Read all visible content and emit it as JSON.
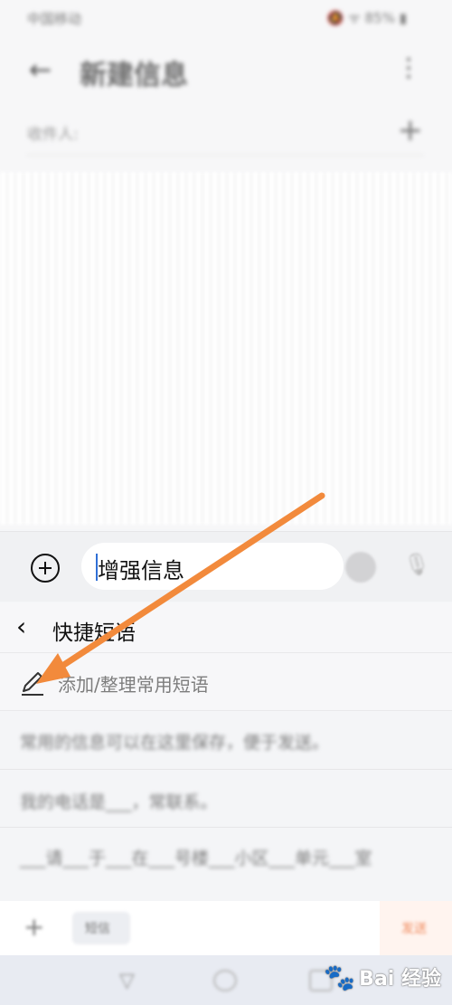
{
  "status_bar": {
    "left": "中国移动",
    "right": "🔕 ᯤ 85% ▮"
  },
  "header": {
    "title": "新建信息"
  },
  "recipient": {
    "placeholder": "收件人:"
  },
  "composer": {
    "input_value": "增强信息"
  },
  "quick_phrases": {
    "title": "快捷短语",
    "add_label": "添加/整理常用短语",
    "items": [
      "常用的信息可以在这里保存，便于发送。",
      "我的电话是___，常联系。",
      "___请___于___在___号楼___小区___单元___室"
    ]
  },
  "bottom_bar": {
    "chip_label": "短信",
    "right_label": "发送"
  },
  "watermark": {
    "text": "Bai 经验"
  },
  "colors": {
    "accent_arrow": "#f28a3c",
    "cursor": "#2f6fd6"
  }
}
